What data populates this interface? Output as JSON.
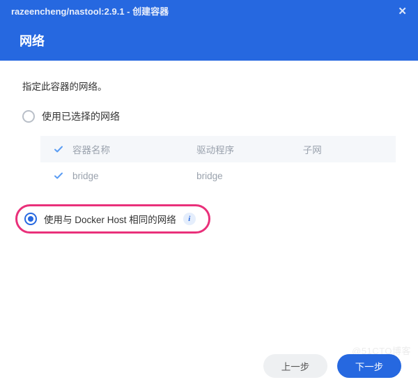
{
  "header": {
    "title": "razeencheng/nastool:2.9.1 - 创建容器",
    "section": "网络"
  },
  "content": {
    "description": "指定此容器的网络。",
    "option_existing": "使用已选择的网络",
    "option_host": "使用与 Docker Host 相同的网络"
  },
  "table": {
    "col_name": "容器名称",
    "col_driver": "驱动程序",
    "col_subnet": "子网",
    "row1_name": "bridge",
    "row1_driver": "bridge"
  },
  "footer": {
    "prev": "上一步",
    "next": "下一步"
  },
  "watermark": "@51CTO博客"
}
